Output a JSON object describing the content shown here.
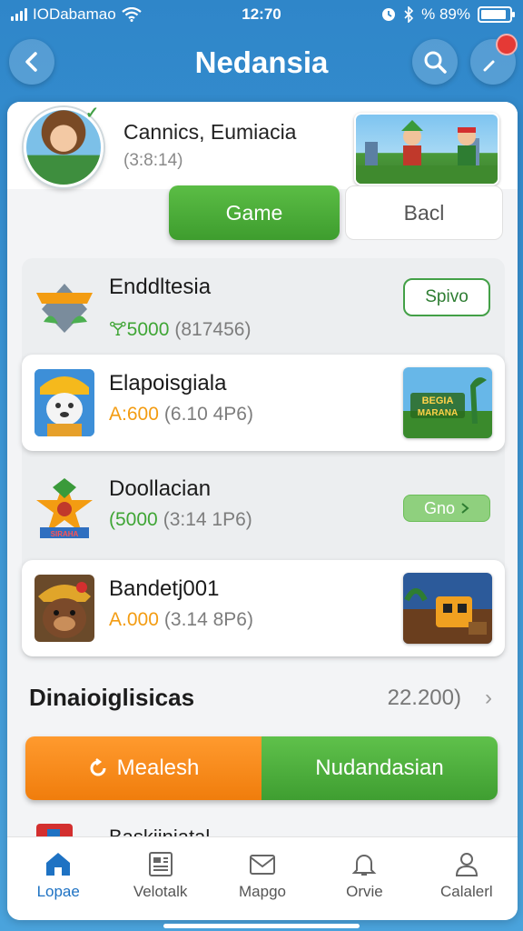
{
  "status_bar": {
    "carrier": "IODabamao",
    "time": "12:70",
    "battery_text": "% 89%",
    "battery_level": 0.89
  },
  "header": {
    "title": "Nedansia",
    "back_icon": "chevron-left-icon",
    "search_icon": "search-icon",
    "pin_icon": "pin-icon"
  },
  "profile": {
    "name": "Cannics, Eumiacia",
    "sub": "(3:8:14)"
  },
  "tabs": {
    "active": "Game",
    "inactive": "Bacl"
  },
  "list": [
    {
      "title": "Enddltesia",
      "value": "5000",
      "sub": "(817456)",
      "value_color": "green",
      "action": "Spivo"
    },
    {
      "title": "Elapoisgiala",
      "value": "A:600",
      "sub": "(6.10 4P6)",
      "value_color": "orange",
      "thumb_label": "BEGIA\nMARANA"
    },
    {
      "title": "Doollacian",
      "value": "(5000",
      "sub": "(3:14 1P6)",
      "value_color": "green",
      "action": "Gno"
    },
    {
      "title": "Bandetj001",
      "value": "A.000",
      "sub": "(3.14 8P6)",
      "value_color": "orange"
    }
  ],
  "section": {
    "title": "Dinaioiglisicas",
    "value": "22.200)"
  },
  "buttons": {
    "left": "Mealesh",
    "right": "Nudandasian"
  },
  "peek": {
    "text": "Baskiiniatal"
  },
  "bottom_nav": [
    {
      "label": "Lopae",
      "icon": "home-icon",
      "active": true
    },
    {
      "label": "Velotalk",
      "icon": "newspaper-icon",
      "active": false
    },
    {
      "label": "Mapgo",
      "icon": "mail-icon",
      "active": false
    },
    {
      "label": "Orvie",
      "icon": "bell-icon",
      "active": false
    },
    {
      "label": "Calalerl",
      "icon": "user-icon",
      "active": false
    }
  ],
  "colors": {
    "accent_green": "#3fa535",
    "accent_orange": "#f39c12",
    "header_blue": "#2f86c9"
  }
}
